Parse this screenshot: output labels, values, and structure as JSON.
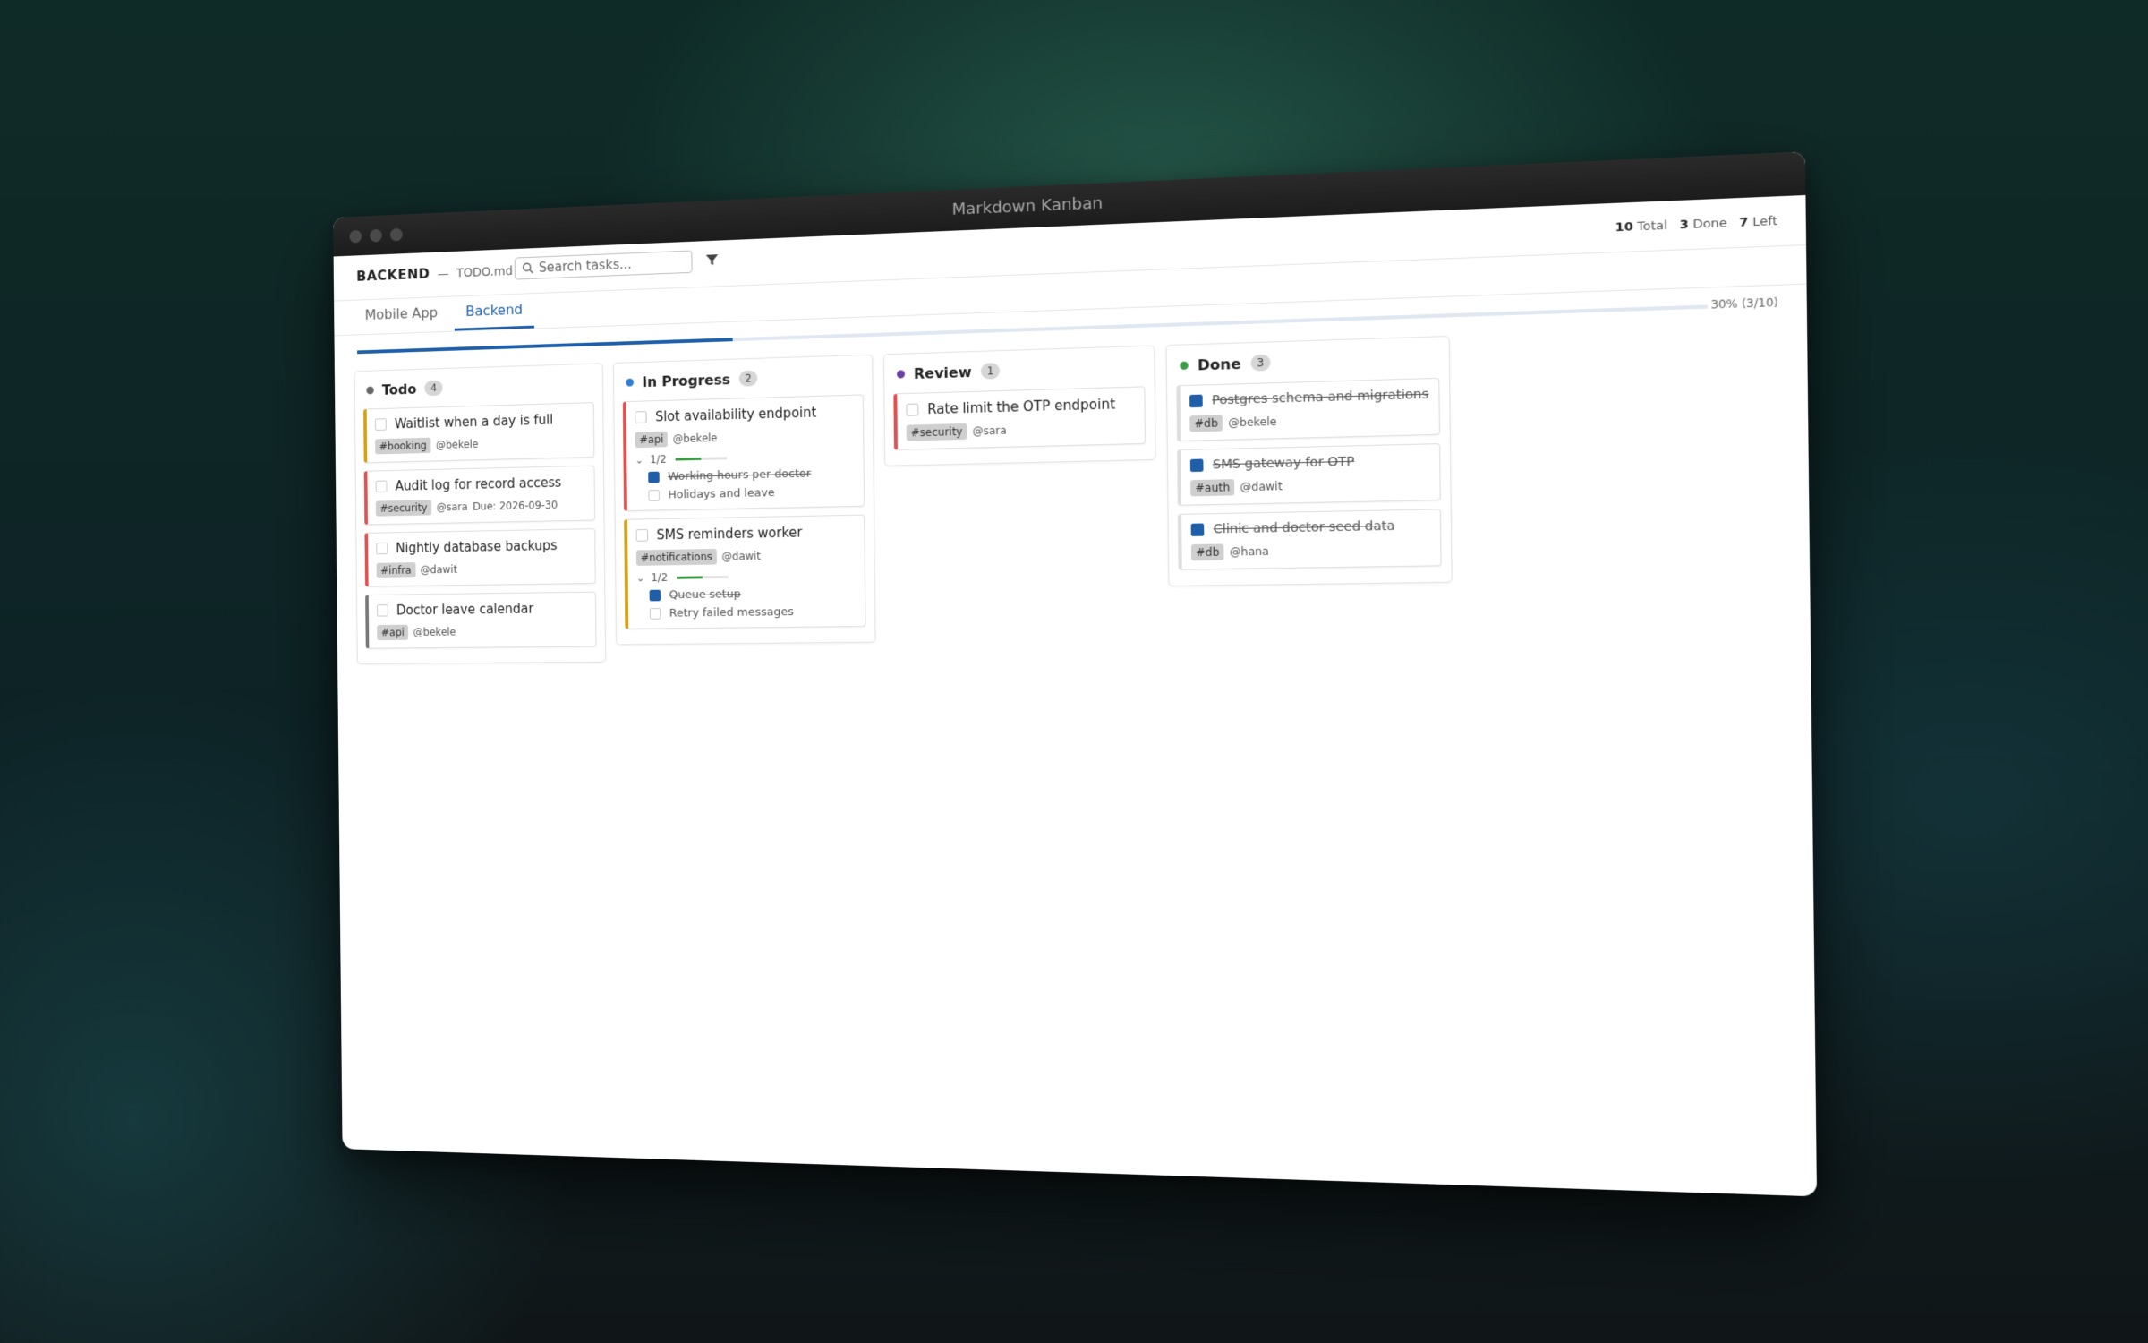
{
  "window": {
    "title": "Markdown Kanban"
  },
  "header": {
    "project": "BACKEND",
    "separator": "—",
    "file": "TODO.md",
    "search_placeholder": "Search tasks...",
    "stats": {
      "total_value": "10",
      "total_label": "Total",
      "done_value": "3",
      "done_label": "Done",
      "left_value": "7",
      "left_label": "Left"
    }
  },
  "tabs": [
    {
      "label": "Mobile App",
      "active": false
    },
    {
      "label": "Backend",
      "active": true
    }
  ],
  "progress": {
    "fraction": 0.3,
    "label": "30% (3/10)",
    "color": "#1f5faa"
  },
  "columns": [
    {
      "title": "Todo",
      "count": "4",
      "dot_color": "#666666",
      "cards": [
        {
          "title": "Waitlist when a day is full",
          "tag": "#booking",
          "assignee": "@bekele",
          "accent": "#d4a017",
          "done": false
        },
        {
          "title": "Audit log for record access",
          "tag": "#security",
          "assignee": "@sara",
          "due": "Due: 2026-09-30",
          "accent": "#e05252",
          "done": false
        },
        {
          "title": "Nightly database backups",
          "tag": "#infra",
          "assignee": "@dawit",
          "accent": "#e05252",
          "done": false
        },
        {
          "title": "Doctor leave calendar",
          "tag": "#api",
          "assignee": "@bekele",
          "accent": "#777777",
          "done": false
        }
      ]
    },
    {
      "title": "In Progress",
      "count": "2",
      "dot_color": "#2f7fd6",
      "cards": [
        {
          "title": "Slot availability endpoint",
          "tag": "#api",
          "assignee": "@bekele",
          "accent": "#e05252",
          "done": false,
          "subtasks": {
            "progress": "1/2",
            "fraction": 0.5,
            "items": [
              {
                "label": "Working hours per doctor",
                "done": true
              },
              {
                "label": "Holidays and leave",
                "done": false
              }
            ]
          }
        },
        {
          "title": "SMS reminders worker",
          "tag": "#notifications",
          "assignee": "@dawit",
          "accent": "#d4a017",
          "done": false,
          "subtasks": {
            "progress": "1/2",
            "fraction": 0.5,
            "items": [
              {
                "label": "Queue setup",
                "done": true
              },
              {
                "label": "Retry failed messages",
                "done": false
              }
            ]
          }
        }
      ]
    },
    {
      "title": "Review",
      "count": "1",
      "dot_color": "#6a3fa0",
      "cards": [
        {
          "title": "Rate limit the OTP endpoint",
          "tag": "#security",
          "assignee": "@sara",
          "accent": "#e05252",
          "done": false
        }
      ]
    },
    {
      "title": "Done",
      "count": "3",
      "dot_color": "#3c9b47",
      "cards": [
        {
          "title": "Postgres schema and migrations",
          "tag": "#db",
          "assignee": "@bekele",
          "accent": "#dedede",
          "done": true
        },
        {
          "title": "SMS gateway for OTP",
          "tag": "#auth",
          "assignee": "@dawit",
          "accent": "#dedede",
          "done": true
        },
        {
          "title": "Clinic and doctor seed data",
          "tag": "#db",
          "assignee": "@hana",
          "accent": "#dedede",
          "done": true
        }
      ]
    }
  ]
}
